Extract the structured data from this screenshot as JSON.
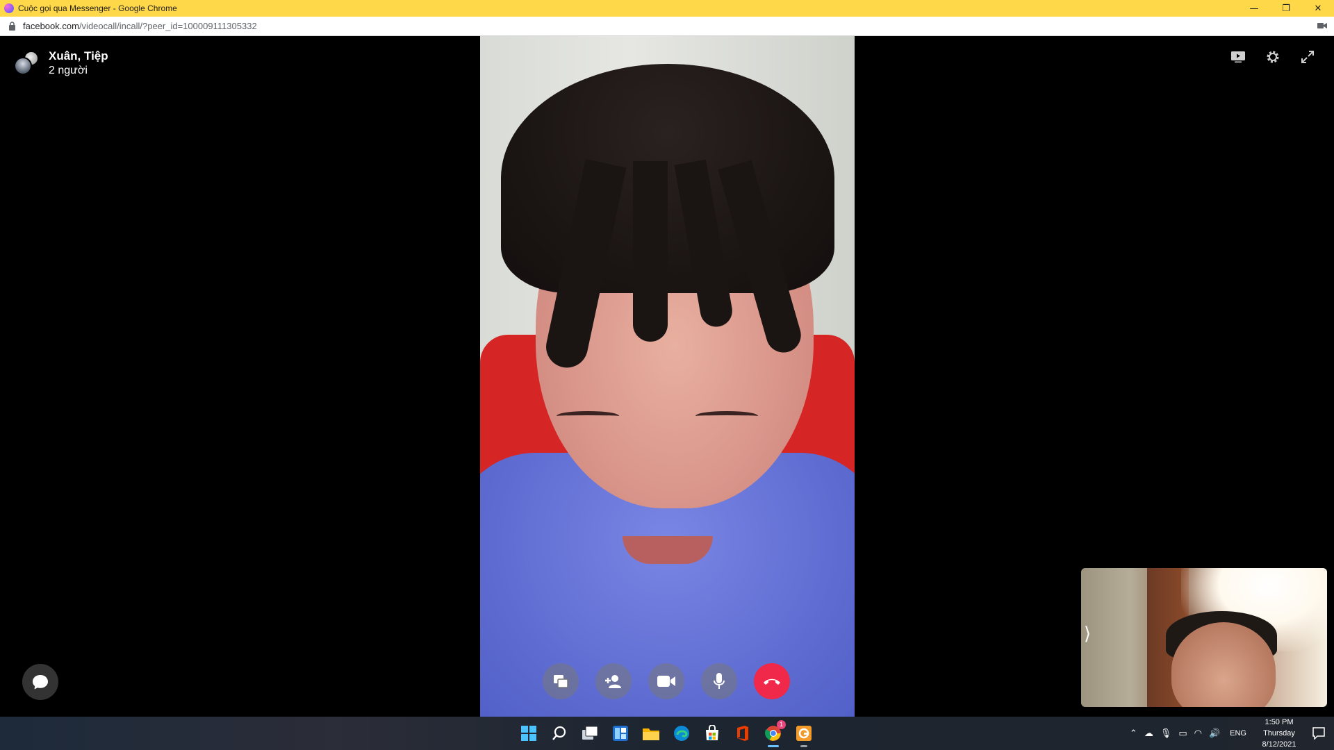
{
  "browser": {
    "title": "Cuộc gọi qua Messenger - Google Chrome",
    "url_domain": "facebook.com",
    "url_path": "/videocall/incall/?peer_id=100009111305332",
    "window_controls": [
      "minimize",
      "restore",
      "close"
    ]
  },
  "call": {
    "participants_name": "Xuân, Tiệp",
    "participants_count": "2 người",
    "top_tools": [
      "screen-share-view-icon",
      "settings-icon",
      "fullscreen-icon"
    ],
    "controls": [
      {
        "name": "share-screen",
        "icon": "screen-share-icon"
      },
      {
        "name": "add-person",
        "icon": "add-person-icon"
      },
      {
        "name": "camera",
        "icon": "video-camera-icon"
      },
      {
        "name": "microphone",
        "icon": "microphone-icon"
      },
      {
        "name": "end-call",
        "icon": "phone-hangup-icon",
        "color": "#f02849"
      }
    ],
    "self_view_expand": "⟩"
  },
  "taskbar": {
    "apps": [
      "windows-start",
      "search",
      "task-view",
      "widgets",
      "file-explorer",
      "edge",
      "microsoft-store",
      "office",
      "chrome",
      "app-orange"
    ],
    "chrome_badge": "1",
    "language": "ENG",
    "time": "1:50 PM",
    "day": "Thursday",
    "date": "8/12/2021"
  }
}
